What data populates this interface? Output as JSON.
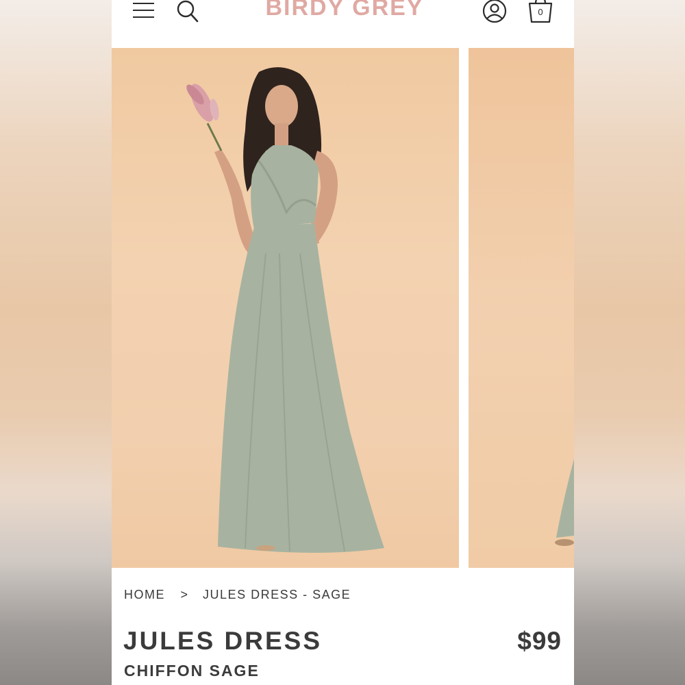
{
  "header": {
    "brand": "BIRDY GREY",
    "menu_icon": "hamburger-menu-icon",
    "search_icon": "search-icon",
    "account_icon": "user-account-icon",
    "cart_icon": "shopping-bag-icon",
    "cart_count": "0"
  },
  "gallery": {
    "images": [
      "model-in-sage-halter-dress",
      "next-product-image"
    ],
    "background_color": "#f2cfae",
    "dress_color": "#a7b3a0"
  },
  "breadcrumb": {
    "home": "HOME",
    "separator": ">",
    "current": "JULES DRESS - SAGE"
  },
  "product": {
    "name": "JULES DRESS",
    "variant": "CHIFFON SAGE",
    "price": "$99"
  },
  "colors": {
    "brand": "#e0a9a3",
    "text": "#3b3b3b"
  }
}
